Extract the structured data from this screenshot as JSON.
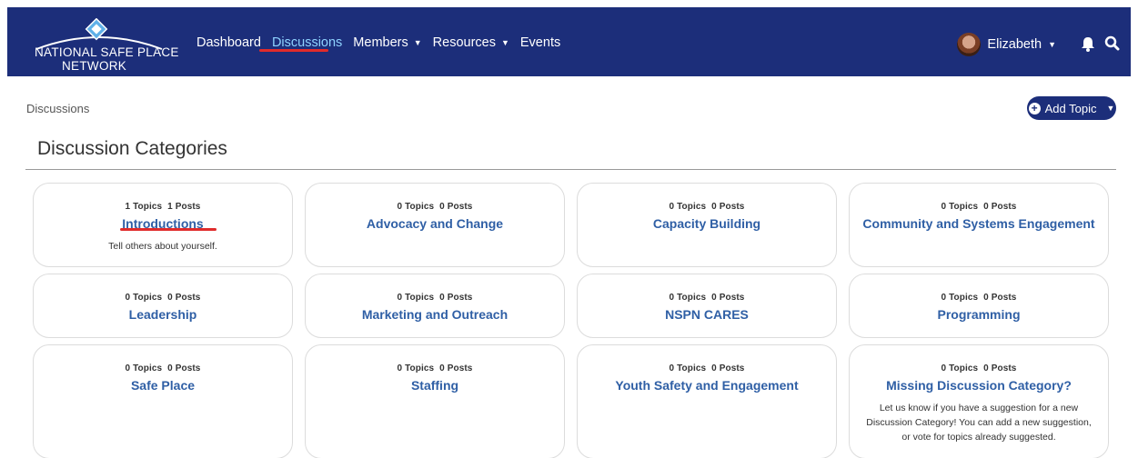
{
  "brand": {
    "line1": "NATIONAL SAFE PLACE",
    "line2": "NETWORK"
  },
  "nav": {
    "items": [
      {
        "label": "Dashboard",
        "active": false,
        "caret": false
      },
      {
        "label": "Discussions",
        "active": true,
        "caret": false
      },
      {
        "label": "Members",
        "active": false,
        "caret": true
      },
      {
        "label": "Resources",
        "active": false,
        "caret": true
      },
      {
        "label": "Events",
        "active": false,
        "caret": false
      }
    ]
  },
  "user": {
    "name": "Elizabeth"
  },
  "icons": {
    "bell": "bell-icon",
    "search": "search-icon",
    "plus": "plus-circle-icon",
    "caret": "caret-down-icon"
  },
  "breadcrumb": "Discussions",
  "add_topic_label": "Add Topic",
  "page_title": "Discussion Categories",
  "colors": {
    "header": "#1c2e7a",
    "link": "#2f5fa5",
    "annotation": "#e02b2b"
  },
  "categories": [
    {
      "topics": "1 Topics",
      "posts": "1 Posts",
      "title": "Introductions",
      "description": "Tell others about yourself."
    },
    {
      "topics": "0 Topics",
      "posts": "0 Posts",
      "title": "Advocacy and Change",
      "description": ""
    },
    {
      "topics": "0 Topics",
      "posts": "0 Posts",
      "title": "Capacity Building",
      "description": ""
    },
    {
      "topics": "0 Topics",
      "posts": "0 Posts",
      "title": "Community and Systems Engagement",
      "description": ""
    },
    {
      "topics": "0 Topics",
      "posts": "0 Posts",
      "title": "Leadership",
      "description": ""
    },
    {
      "topics": "0 Topics",
      "posts": "0 Posts",
      "title": "Marketing and Outreach",
      "description": ""
    },
    {
      "topics": "0 Topics",
      "posts": "0 Posts",
      "title": "NSPN CARES",
      "description": ""
    },
    {
      "topics": "0 Topics",
      "posts": "0 Posts",
      "title": "Programming",
      "description": ""
    },
    {
      "topics": "0 Topics",
      "posts": "0 Posts",
      "title": "Safe Place",
      "description": ""
    },
    {
      "topics": "0 Topics",
      "posts": "0 Posts",
      "title": "Staffing",
      "description": ""
    },
    {
      "topics": "0 Topics",
      "posts": "0 Posts",
      "title": "Youth Safety and Engagement",
      "description": ""
    },
    {
      "topics": "0 Topics",
      "posts": "0 Posts",
      "title": "Missing Discussion Category?",
      "description": "Let us know if you have a suggestion for a new Discussion Category! You can add a new suggestion, or vote for topics already suggested."
    }
  ]
}
